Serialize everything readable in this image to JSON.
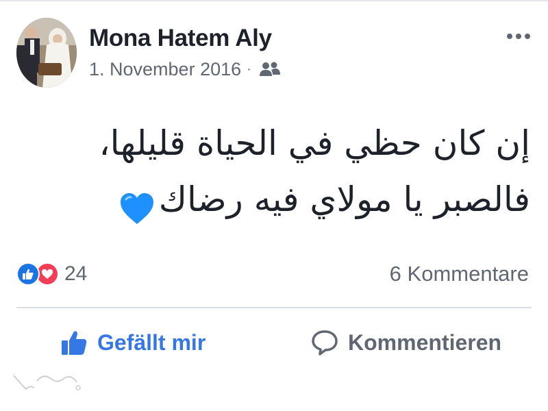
{
  "post": {
    "author": "Mona Hatem Aly",
    "date": "1. November 2016",
    "separator": "·",
    "audience_icon": "friends-icon",
    "more_icon": "more-options-icon",
    "message_lines": [
      "إن كان حظي في الحياة قليلها،",
      "فالصبر يا مولاي فيه رضاك"
    ],
    "emoji": "blue-heart-icon"
  },
  "reactions": {
    "types": [
      "like",
      "love"
    ],
    "count": "24",
    "comments_label": "6 Kommentare"
  },
  "actions": {
    "like_label": "Gefällt mir",
    "comment_label": "Kommentieren"
  },
  "colors": {
    "like_blue": "#3578e5",
    "love_red": "#f33e58",
    "heart_blue": "#1e90ff",
    "secondary_text": "#606770"
  }
}
